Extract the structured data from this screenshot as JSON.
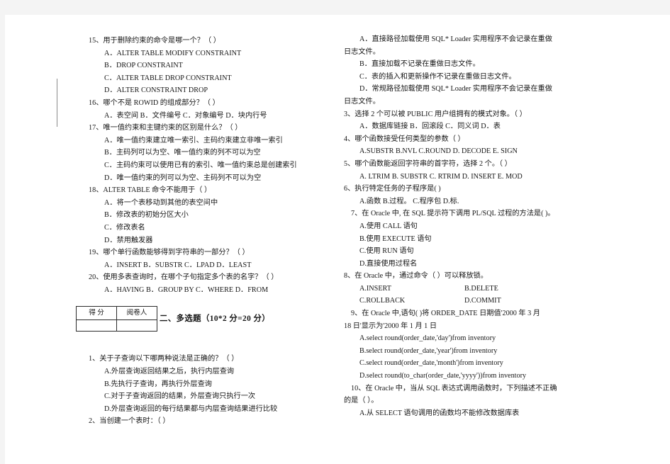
{
  "document": {
    "type": "exam-paper-scan",
    "language": "zh-CN",
    "page_background": "#ffffff",
    "canvas_background": "#f4f4f4",
    "text_color": "#161616"
  },
  "left_column": {
    "q15": {
      "stem": "15、用于删除约束的命令是哪一个？（    ）",
      "options": [
        "A．ALTER TABLE MODIFY CONSTRAINT",
        "B．DROP CONSTRAINT",
        "C．ALTER TABLE DROP CONSTRAINT",
        "D．ALTER CONSTRAINT DROP"
      ]
    },
    "q16": {
      "stem": "16、哪个不是 ROWID 的组成部分？（    ）",
      "options_inline": "A．表空间      B．文件编号     C．对象编号      D．块内行号"
    },
    "q17": {
      "stem": "17、唯一值约束和主键约束的区别是什么？（    ）",
      "options": [
        "A．唯一值约束建立唯一索引、主码约束建立非唯一索引",
        "B．主码列可以为空、唯一值约束的列不可以为空",
        "C．主码约束可以使用已有的索引、唯一值约束总是创建索引",
        "D．唯一值约束的列可以为空、主码列不可以为空"
      ]
    },
    "q18": {
      "stem": "18、ALTER TABLE 命令不能用于（    ）",
      "options": [
        "A．将一个表移动到其他的表空间中",
        "B．修改表的初始分区大小",
        "C．修改表名",
        "D．禁用触发器"
      ]
    },
    "q19": {
      "stem": "19、哪个单行函数能够得到字符串的一部分？（    ）",
      "options_inline": "A．INSERT      B．SUBSTR      C．LPAD        D．LEAST"
    },
    "q20": {
      "stem": "20、使用多表查询时，在哪个子句指定多个表的名字？（    ）",
      "options_inline": "A．HAVING      B．GROUP BY      C．WHERE      D．FROM"
    },
    "score_table": {
      "headers": [
        "得  分",
        "阅卷人"
      ],
      "values": [
        "",
        ""
      ]
    },
    "section_heading": "二、多选题（10*2 分=20 分）",
    "m1": {
      "stem": "1、关于子查询以下哪两种说法是正确的？（    ）",
      "options": [
        "A.外层查询返回结果之后，执行内层查询",
        "B.先执行子查询，再执行外层查询",
        "C.对于子查询返回的结果，外层查询只执行一次",
        "D.外层查询返回的每行结果都与内层查询结果进行比较"
      ]
    },
    "m2": {
      "stem": "2、当创建一个表时：（    ）"
    }
  },
  "right_column": {
    "q_continued": {
      "options": [
        "A．直接路径加载使用 SQL* Loader 实用程序不会记录在重做",
        "日志文件。",
        "B．直接加载不记录在重做日志文件。",
        "C．表的插入和更新操作不记录在重做日志文件。",
        "D．常规路径加载使用 SQL* Loader 实用程序不会记录在重做",
        "日志文件。"
      ]
    },
    "m3": {
      "stem": "3、选择 2 个可以被 PUBLIC 用户组拥有的模式对象。（    ）",
      "options_inline": "A．数据库链接      B．回滚段      C．同义词      D．表"
    },
    "m4": {
      "stem": "4、哪个函数接受任何类型的参数（      ）",
      "options_inline": "A.SUBSTR     B.NVL      C.ROUND     D. DECODE     E. SIGN"
    },
    "m5": {
      "stem": "5、哪个函数能返回字符串的首字符，选择 2 个。（      ）",
      "options_inline": "A. LTRIM      B. SUBSTR   C. RTRIM   D. INSERT     E. MOD"
    },
    "m6": {
      "stem": "6、执行特定任务的子程序是(       )",
      "options_inline": "A.函数                B.过程。              C.程序包             D.标."
    },
    "m7": {
      "stem": "7、在 Oracle 中, 在 SQL 提示符下调用 PL/SQL 过程的方法是(     )。",
      "options": [
        "A.使用 CALL 语句",
        "B.使用 EXECUTE 语句",
        "C.使用 RUN 语句",
        "D.直接使用过程名"
      ]
    },
    "m8": {
      "stem": "8、在 Oracle 中，通过命令（        ）可以释放锁。",
      "options_grid": [
        [
          "A.INSERT",
          "B.DELETE"
        ],
        [
          "C.ROLLBACK",
          "D.COMMIT"
        ]
      ]
    },
    "m9": {
      "stem_line1": "9、在 Oracle 中,语句(           )将 ORDER_DATE 日期值'2000 年 3 月",
      "stem_line2": "18 日'显示为'2000 年 1 月 1 日",
      "options": [
        "A.select round(order_date,'day')from inventory",
        "B.select round(order_date,'year')from inventory",
        "C.select round(order_date,'month')from inventory",
        "D.select round(to_char(order_date,'yyyy'))from inventory"
      ]
    },
    "m10": {
      "stem_line1": "10、在 Oracle 中，当从 SQL 表达式调用函数时，下列描述不正确",
      "stem_line2": "的是（          ）。",
      "options": [
        "A.从 SELECT 语句调用的函数均不能修改数据库表"
      ]
    }
  }
}
